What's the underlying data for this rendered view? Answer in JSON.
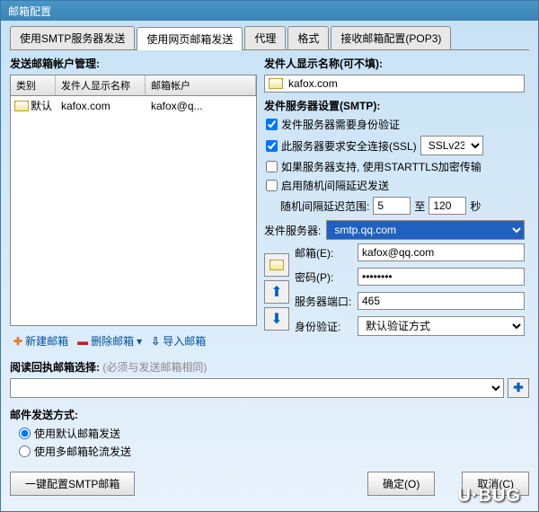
{
  "window_title": "邮箱配置",
  "tabs": [
    "使用SMTP服务器发送",
    "使用网页邮箱发送",
    "代理",
    "格式",
    "接收邮箱配置(POP3)"
  ],
  "active_tab": 1,
  "left": {
    "title": "发送邮箱帐户管理:",
    "columns": [
      "类别",
      "发件人显示名称",
      "邮箱帐户"
    ],
    "row": {
      "type": "默认",
      "name": "kafox.com",
      "acct": "kafox@q..."
    },
    "toolbar": {
      "new": "新建邮箱",
      "del": "删除邮箱",
      "imp": "导入邮箱"
    }
  },
  "right": {
    "sender_label": "发件人显示名称(可不填):",
    "sender_value": "kafox.com",
    "smtp_label": "发件服务器设置(SMTP):",
    "chk1": "发件服务器需要身份验证",
    "chk2": "此服务器要求安全连接(SSL)",
    "ssl_opt": "SSLv23",
    "chk3": "如果服务器支持, 使用STARTTLS加密传输",
    "chk4": "启用随机间隔延迟发送",
    "delay_label": "随机间隔延迟范围:",
    "delay_from": "5",
    "delay_to": "120",
    "delay_unit": "至",
    "delay_sec": "秒",
    "server_label": "发件服务器:",
    "server_value": "smtp.qq.com",
    "mail_label": "邮箱(E):",
    "mail_value": "kafox@qq.com",
    "pwd_label": "密码(P):",
    "pwd_value": "********",
    "port_label": "服务器端口:",
    "port_value": "465",
    "auth_label": "身份验证:",
    "auth_value": "默认验证方式"
  },
  "reply": {
    "label": "阅读回执邮箱选择:",
    "hint": "(必须与发送邮箱相同)"
  },
  "send_mode": {
    "label": "邮件发送方式:",
    "opt1": "使用默认邮箱发送",
    "opt2": "使用多邮箱轮流发送"
  },
  "footer": {
    "autoconf": "一键配置SMTP邮箱",
    "ok": "确定(O)",
    "cancel": "取消(C)"
  },
  "watermark": "U·BUG"
}
